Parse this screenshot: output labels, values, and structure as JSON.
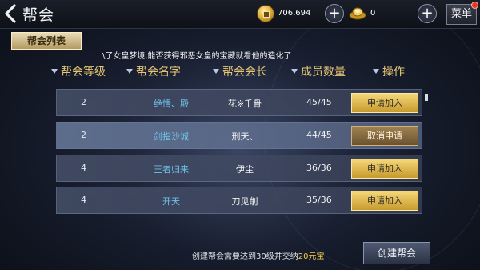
{
  "header": {
    "title": "帮会",
    "coins": "706,694",
    "gold": "0",
    "menu_label": "菜单"
  },
  "tab": {
    "label": "帮会列表"
  },
  "ticker": "\\了女皇梦境,能否获得邪恶女皇的宝藏就看他的造化了",
  "columns": {
    "level": "帮会等级",
    "name": "帮会名字",
    "leader": "帮会会长",
    "members": "成员数量",
    "action": "操作"
  },
  "guilds": [
    {
      "level": "2",
      "name": "绝情、殿",
      "leader": "花※千骨",
      "members": "45/45",
      "action": "申请加入"
    },
    {
      "level": "2",
      "name": "剑指沙城",
      "leader": "刑天、",
      "members": "44/45",
      "action": "取消申请"
    },
    {
      "level": "4",
      "name": "王者归来",
      "leader": "伊尘",
      "members": "36/36",
      "action": "申请加入"
    },
    {
      "level": "4",
      "name": "开天",
      "leader": "刀见削",
      "members": "35/36",
      "action": "申请加入"
    }
  ],
  "footer": {
    "requirement_prefix": "创建帮会需要达到30级并交纳",
    "requirement_cost": "20元宝",
    "create_button": "创建帮会"
  },
  "colors": {
    "accent_gold": "#e6c675",
    "guild_name": "#6fc2e8",
    "highlight": "#f2c84b"
  }
}
